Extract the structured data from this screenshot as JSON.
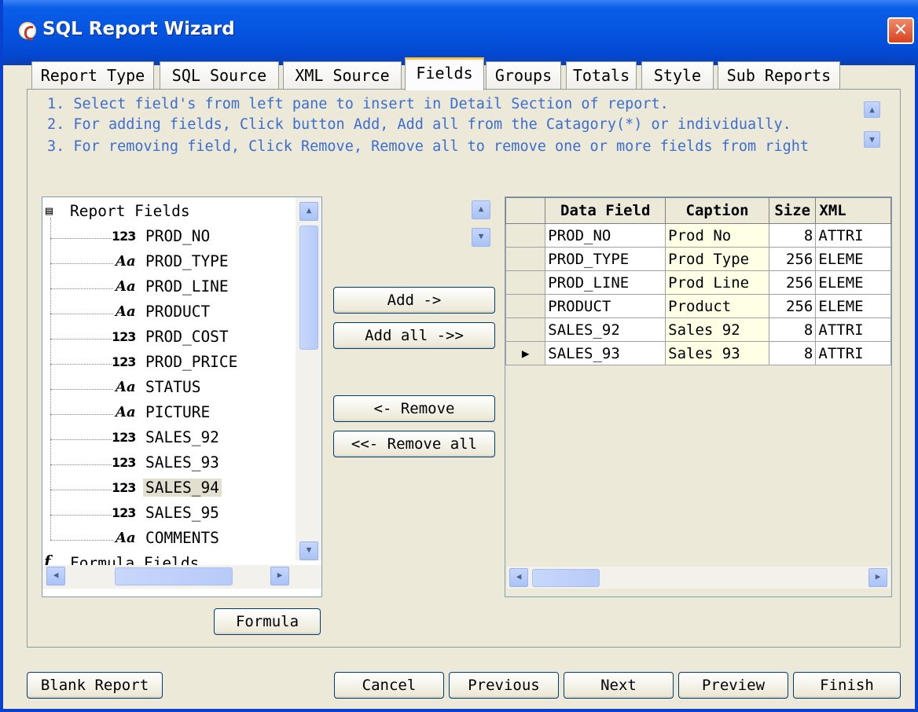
{
  "window": {
    "title": "SQL Report Wizard",
    "close": "✕"
  },
  "tabs": [
    {
      "label": "Report Type"
    },
    {
      "label": "SQL Source"
    },
    {
      "label": "XML Source"
    },
    {
      "label": "Fields",
      "active": true
    },
    {
      "label": "Groups"
    },
    {
      "label": "Totals"
    },
    {
      "label": "Style"
    },
    {
      "label": "Sub Reports"
    }
  ],
  "instructions": [
    "1. Select field's from left pane to insert in Detail Section of report.",
    "2. For adding fields,  Click button Add, Add all from the Catagory(*) or individually.",
    "3. For removing field, Click Remove, Remove all to remove one or more fields from right"
  ],
  "tree": {
    "root": "Report Fields",
    "fields": [
      {
        "type": "123",
        "name": "PROD_NO"
      },
      {
        "type": "Aa",
        "name": "PROD_TYPE"
      },
      {
        "type": "Aa",
        "name": "PROD_LINE"
      },
      {
        "type": "Aa",
        "name": "PRODUCT"
      },
      {
        "type": "123",
        "name": "PROD_COST"
      },
      {
        "type": "123",
        "name": "PROD_PRICE"
      },
      {
        "type": "Aa",
        "name": "STATUS"
      },
      {
        "type": "Aa",
        "name": "PICTURE"
      },
      {
        "type": "123",
        "name": "SALES_92"
      },
      {
        "type": "123",
        "name": "SALES_93"
      },
      {
        "type": "123",
        "name": "SALES_94",
        "selected": true
      },
      {
        "type": "123",
        "name": "SALES_95"
      },
      {
        "type": "Aa",
        "name": "COMMENTS"
      }
    ],
    "formula_root": "Formula Fields",
    "formula_icon": "f"
  },
  "buttons": {
    "add": "Add ->",
    "add_all": "Add all ->>",
    "remove": "<- Remove",
    "remove_all": "<<- Remove all",
    "formula": "Formula",
    "blank_report": "Blank Report",
    "cancel": "Cancel",
    "previous": "Previous",
    "next": "Next",
    "preview": "Preview",
    "finish": "Finish"
  },
  "grid": {
    "columns": [
      "Data Field",
      "Caption",
      "Size",
      "XML"
    ],
    "rows": [
      {
        "field": "PROD_NO",
        "caption": "Prod No",
        "size": "8",
        "xml": "ATTRI"
      },
      {
        "field": "PROD_TYPE",
        "caption": "Prod Type",
        "size": "256",
        "xml": "ELEME"
      },
      {
        "field": "PROD_LINE",
        "caption": "Prod Line",
        "size": "256",
        "xml": "ELEME"
      },
      {
        "field": "PRODUCT",
        "caption": "Product",
        "size": "256",
        "xml": "ELEME"
      },
      {
        "field": "SALES_92",
        "caption": "Sales 92",
        "size": "8",
        "xml": "ATTRI"
      },
      {
        "field": "SALES_93",
        "caption": "Sales 93",
        "size": "8",
        "xml": "ATTRI",
        "current": true
      }
    ]
  },
  "colors": {
    "titlebar": "#0554e0",
    "instructions": "#3c6ed0",
    "caption_cell": "#ffffe6"
  }
}
